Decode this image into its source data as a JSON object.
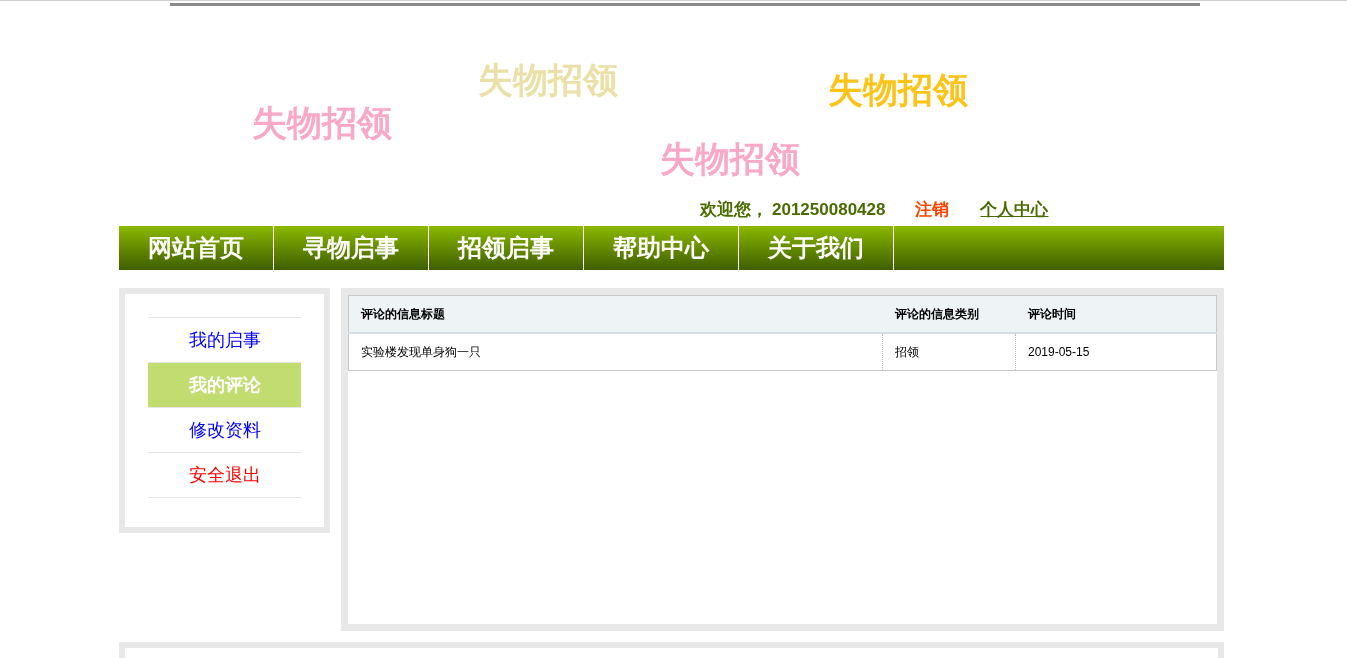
{
  "banner": {
    "slogans": [
      {
        "text": "失物招领",
        "color": "#f9a8c8"
      },
      {
        "text": "失物招领",
        "color": "#ebe0a8"
      },
      {
        "text": "失物招领",
        "color": "#fcc419"
      },
      {
        "text": "失物招领",
        "color": "#f9a8c8"
      }
    ]
  },
  "user_bar": {
    "greeting": "欢迎您，",
    "user_id": "201250080428",
    "logout": "注销",
    "profile": "个人中心"
  },
  "nav": [
    "网站首页",
    "寻物启事",
    "招领启事",
    "帮助中心",
    "关于我们"
  ],
  "sidebar": {
    "items": [
      {
        "label": "我的启事",
        "selected": false,
        "kind": "link"
      },
      {
        "label": "我的评论",
        "selected": true,
        "kind": "link"
      },
      {
        "label": "修改资料",
        "selected": false,
        "kind": "link"
      },
      {
        "label": "安全退出",
        "selected": false,
        "kind": "logout"
      }
    ]
  },
  "table": {
    "columns": [
      "评论的信息标题",
      "评论的信息类别",
      "评论时间"
    ],
    "rows": [
      [
        "实验楼发现单身狗一只",
        "招领",
        "2019-05-15"
      ]
    ]
  }
}
